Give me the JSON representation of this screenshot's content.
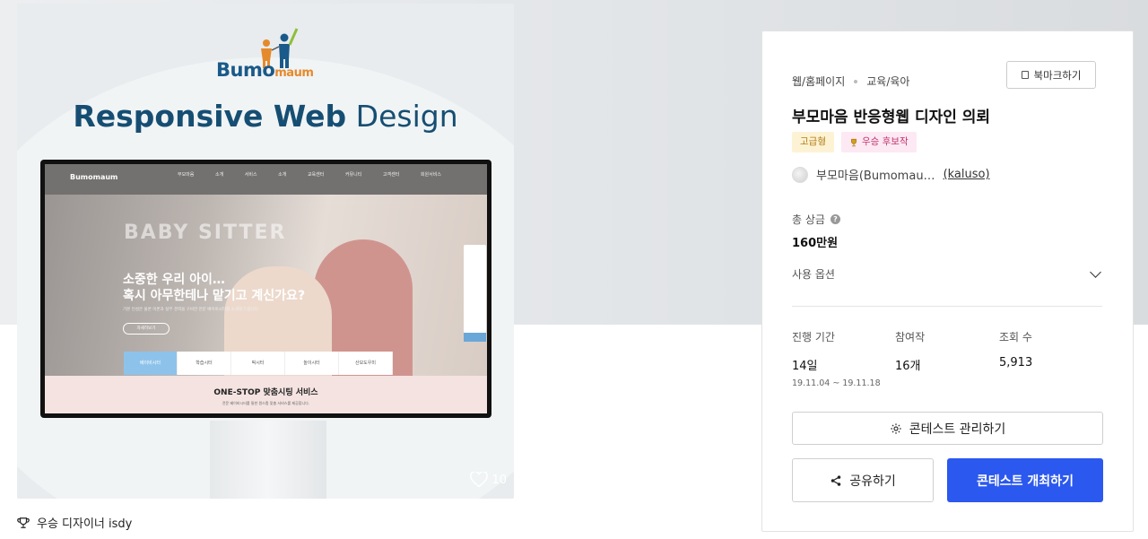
{
  "showcase": {
    "brand_main": "Bumo",
    "brand_sub": "maum",
    "headline_bold": "Responsive Web",
    "headline_rest": "Design",
    "screen": {
      "logo": "Bumomaum",
      "nav_items": "부모마음 소개 서비스 소개 교육센터 커뮤니티 고객센터 회원서비스",
      "hero_big": "BABY SITTER",
      "hero_title_1": "소중한 우리 아이…",
      "hero_title_2": "혹시 아무한테나 맡기고 계신가요?",
      "hero_sub": "기본 인성은 물론 이론과 실무 경력을 구비한 전문 베이비시터를 소개해 드립니다.",
      "hero_btn": "자세히보기",
      "tabs": [
        "베이비시터",
        "학습시터",
        "픽시터",
        "놀이시터",
        "산모도우미"
      ],
      "bottom_title": "ONE-STOP 맞춤시팅 서비스",
      "bottom_sub": "전문 베이비시터를 통한 원스톱 맞춤 서비스를 제공합니다."
    },
    "likes": "10",
    "winner_text": "우승 디자이너 isdy"
  },
  "panel": {
    "crumb_1": "웹/홈페이지",
    "crumb_2": "교육/육아",
    "bookmark_label": "북마크하기",
    "title": "부모마음 반응형웹 디자인 의뢰",
    "badge_grade": "고급형",
    "badge_winner": "우승 후보작",
    "host_name": "부모마음(Bumomau…",
    "host_handle": "(kaluso)",
    "prize_label": "총 상금",
    "prize_value": "160만원",
    "option_label": "사용 옵션",
    "stats": {
      "period_label": "진행 기간",
      "period_value": "14일",
      "period_dates": "19.11.04 ~ 19.11.18",
      "entries_label": "참여작",
      "entries_value": "16개",
      "views_label": "조회 수",
      "views_value": "5,913"
    },
    "manage_label": "콘테스트 관리하기",
    "share_label": "공유하기",
    "host_contest_label": "콘테스트 개최하기"
  },
  "colors": {
    "primary": "#2b58ee",
    "brand_blue": "#164e73",
    "brand_orange": "#e58a2c"
  }
}
